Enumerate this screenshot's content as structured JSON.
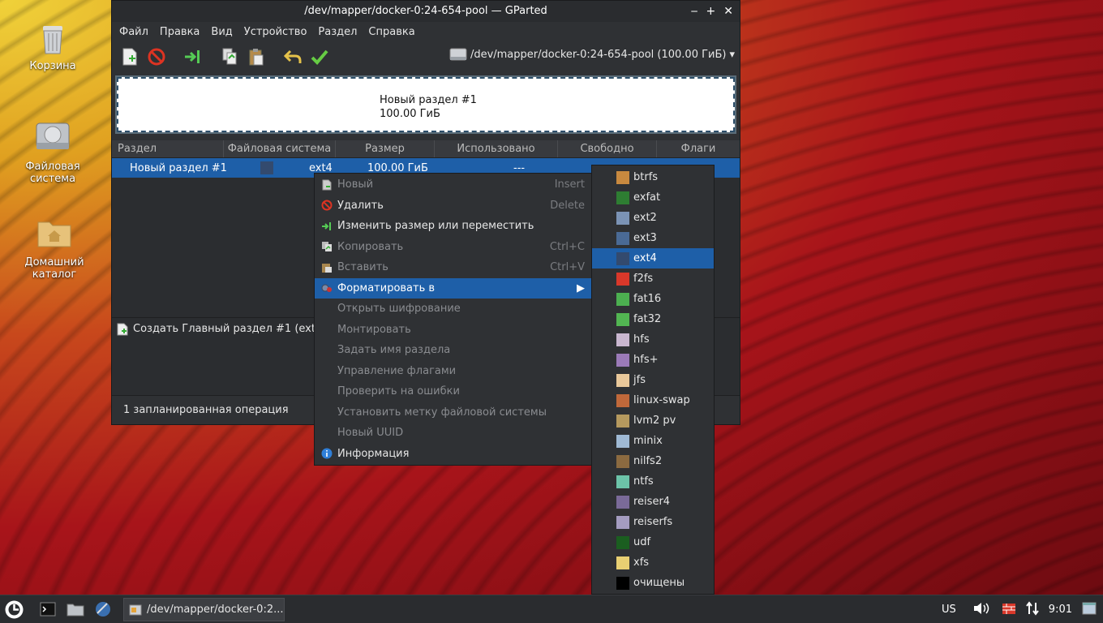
{
  "desktop": {
    "icons": [
      {
        "label": "Корзина"
      },
      {
        "label": "Файловая\nсистема"
      },
      {
        "label": "Домашний\nкаталог"
      }
    ]
  },
  "window": {
    "title": "/dev/mapper/docker-0:24-654-pool — GParted",
    "controls": {
      "min": "‒",
      "max": "+",
      "close": "✕"
    },
    "menu": [
      "Файл",
      "Правка",
      "Вид",
      "Устройство",
      "Раздел",
      "Справка"
    ],
    "device_selector": "/dev/mapper/docker-0:24-654-pool (100.00 ГиБ)",
    "diskmap": {
      "name": "Новый раздел #1",
      "size": "100.00 ГиБ"
    },
    "columns": [
      "Раздел",
      "Файловая система",
      "Размер",
      "Использовано",
      "Свободно",
      "Флаги"
    ],
    "row": {
      "partition": "Новый раздел #1",
      "fs": "ext4",
      "size": "100.00 ГиБ",
      "used": "---"
    },
    "pending_op": "Создать Главный раздел #1 (ext4,",
    "status": "1 запланированная операция"
  },
  "context_menu": {
    "items": [
      {
        "label": "Новый",
        "accel": "Insert",
        "disabled": true,
        "icon": "new-icon"
      },
      {
        "label": "Удалить",
        "accel": "Delete",
        "disabled": false,
        "icon": "delete-icon"
      },
      {
        "label": "Изменить размер или переместить",
        "accel": "",
        "disabled": false,
        "icon": "resize-icon"
      },
      {
        "label": "Копировать",
        "accel": "Ctrl+C",
        "disabled": true,
        "icon": "copy-icon"
      },
      {
        "label": "Вставить",
        "accel": "Ctrl+V",
        "disabled": true,
        "icon": "paste-icon"
      },
      {
        "label": "Форматировать в",
        "accel": "",
        "disabled": false,
        "icon": "format-icon",
        "highlighted": true
      },
      {
        "label": "Открыть шифрование",
        "accel": "",
        "disabled": true
      },
      {
        "label": "Монтировать",
        "accel": "",
        "disabled": true
      },
      {
        "label": "Задать имя раздела",
        "accel": "",
        "disabled": true
      },
      {
        "label": "Управление флагами",
        "accel": "",
        "disabled": true
      },
      {
        "label": "Проверить на ошибки",
        "accel": "",
        "disabled": true
      },
      {
        "label": "Установить метку файловой системы",
        "accel": "",
        "disabled": true
      },
      {
        "label": "Новый UUID",
        "accel": "",
        "disabled": true
      },
      {
        "label": "Информация",
        "accel": "",
        "disabled": false,
        "icon": "info-icon"
      }
    ]
  },
  "format_submenu": {
    "items": [
      {
        "label": "btrfs",
        "color": "#c8893f"
      },
      {
        "label": "exfat",
        "color": "#2e7d32"
      },
      {
        "label": "ext2",
        "color": "#7b93b5"
      },
      {
        "label": "ext3",
        "color": "#4a6a95"
      },
      {
        "label": "ext4",
        "color": "#334a6e",
        "highlighted": true
      },
      {
        "label": "f2fs",
        "color": "#d9382a"
      },
      {
        "label": "fat16",
        "color": "#4caf50"
      },
      {
        "label": "fat32",
        "color": "#52b552"
      },
      {
        "label": "hfs",
        "color": "#c9b6cf"
      },
      {
        "label": "hfs+",
        "color": "#9b7ab8"
      },
      {
        "label": "jfs",
        "color": "#e9c89a"
      },
      {
        "label": "linux-swap",
        "color": "#c0683a"
      },
      {
        "label": "lvm2 pv",
        "color": "#b5995e"
      },
      {
        "label": "minix",
        "color": "#9fb9d4"
      },
      {
        "label": "nilfs2",
        "color": "#8b6a40"
      },
      {
        "label": "ntfs",
        "color": "#6cc3a8"
      },
      {
        "label": "reiser4",
        "color": "#7a6a98"
      },
      {
        "label": "reiserfs",
        "color": "#a49cc0"
      },
      {
        "label": "udf",
        "color": "#1b5e20"
      },
      {
        "label": "xfs",
        "color": "#e8cf72"
      },
      {
        "label": "очищены",
        "color": "#000000"
      }
    ]
  },
  "taskbar": {
    "task_label": "/dev/mapper/docker-0:2...",
    "keyboard_layout": "US",
    "clock": "9:01"
  }
}
